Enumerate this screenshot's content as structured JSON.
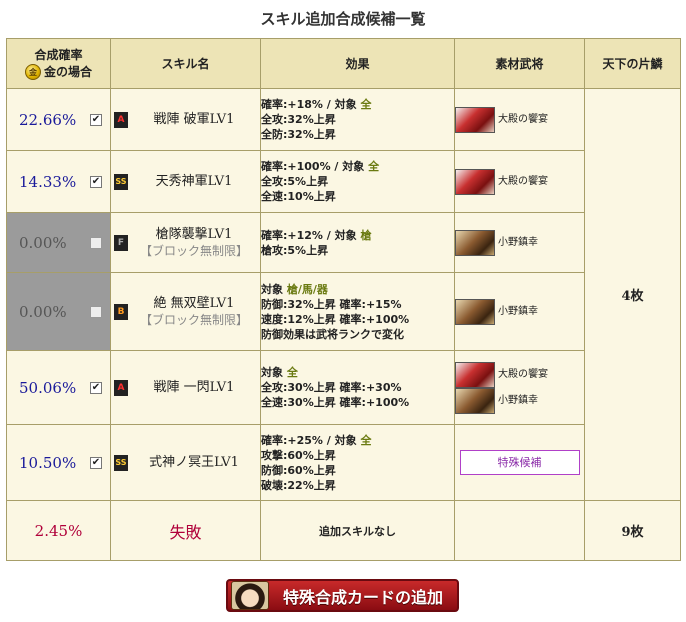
{
  "title": "スキル追加合成候補一覧",
  "headers": {
    "rate": "合成確率",
    "gold_label": "金の場合",
    "gold_icon_text": "金",
    "skill": "スキル名",
    "effect": "効果",
    "material": "素材武将",
    "cards": "天下の片鱗"
  },
  "rows": [
    {
      "rate": "22.66%",
      "checked": "✔",
      "grade": "A",
      "skill": "戦陣 破軍LV1",
      "sub": "",
      "effect": [
        {
          "a": "確率:+18% / 対象 ",
          "b": "全"
        },
        {
          "a": "全攻:32%上昇",
          "b": ""
        },
        {
          "a": "全防:32%上昇",
          "b": ""
        }
      ],
      "materials": [
        {
          "name": "大殿の饗宴",
          "style": "red"
        }
      ],
      "special": ""
    },
    {
      "rate": "14.33%",
      "checked": "✔",
      "grade": "SS",
      "skill": "天秀神軍LV1",
      "sub": "",
      "effect": [
        {
          "a": "確率:+100% / 対象 ",
          "b": "全"
        },
        {
          "a": "全攻:5%上昇",
          "b": ""
        },
        {
          "a": "全速:10%上昇",
          "b": ""
        }
      ],
      "materials": [
        {
          "name": "大殿の饗宴",
          "style": "red"
        }
      ],
      "special": ""
    },
    {
      "rate": "0.00%",
      "checked": "",
      "grade": "F",
      "skill": "槍隊襲撃LV1",
      "sub": "【ブロック無制限】",
      "effect": [
        {
          "a": "確率:+12% / 対象 ",
          "b": "槍"
        },
        {
          "a": "槍攻:5%上昇",
          "b": ""
        }
      ],
      "materials": [
        {
          "name": "小野鎮幸",
          "style": "brown"
        }
      ],
      "special": ""
    },
    {
      "rate": "0.00%",
      "checked": "",
      "grade": "B",
      "skill": "絶 無双壁LV1",
      "sub": "【ブロック無制限】",
      "effect": [
        {
          "a": "対象 ",
          "b": "槍/馬/器"
        },
        {
          "a": "防御:32%上昇  確率:+15%",
          "b": ""
        },
        {
          "a": "速度:12%上昇  確率:+100%",
          "b": ""
        },
        {
          "a": "防御効果は武将ランクで変化",
          "b": ""
        }
      ],
      "materials": [
        {
          "name": "小野鎮幸",
          "style": "brown"
        }
      ],
      "special": ""
    },
    {
      "rate": "50.06%",
      "checked": "✔",
      "grade": "A",
      "skill": "戦陣 一閃LV1",
      "sub": "",
      "effect": [
        {
          "a": "対象 ",
          "b": "全"
        },
        {
          "a": "全攻:30%上昇  確率:+30%",
          "b": ""
        },
        {
          "a": "全速:30%上昇  確率:+100%",
          "b": ""
        }
      ],
      "materials": [
        {
          "name": "大殿の饗宴",
          "style": "red"
        },
        {
          "name": "小野鎮幸",
          "style": "brown"
        }
      ],
      "special": ""
    },
    {
      "rate": "10.50%",
      "checked": "✔",
      "grade": "SS",
      "skill": "式神ノ冥王LV1",
      "sub": "",
      "effect": [
        {
          "a": "確率:+25% / 対象 ",
          "b": "全"
        },
        {
          "a": "攻撃:60%上昇",
          "b": ""
        },
        {
          "a": "防御:60%上昇",
          "b": ""
        },
        {
          "a": "破壊:22%上昇",
          "b": ""
        }
      ],
      "materials": [],
      "special": "特殊候補"
    }
  ],
  "cards_value": "4枚",
  "fail": {
    "rate": "2.45%",
    "label": "失敗",
    "effect": "追加スキルなし",
    "cards": "9枚"
  },
  "add_button": "特殊合成カードの追加"
}
